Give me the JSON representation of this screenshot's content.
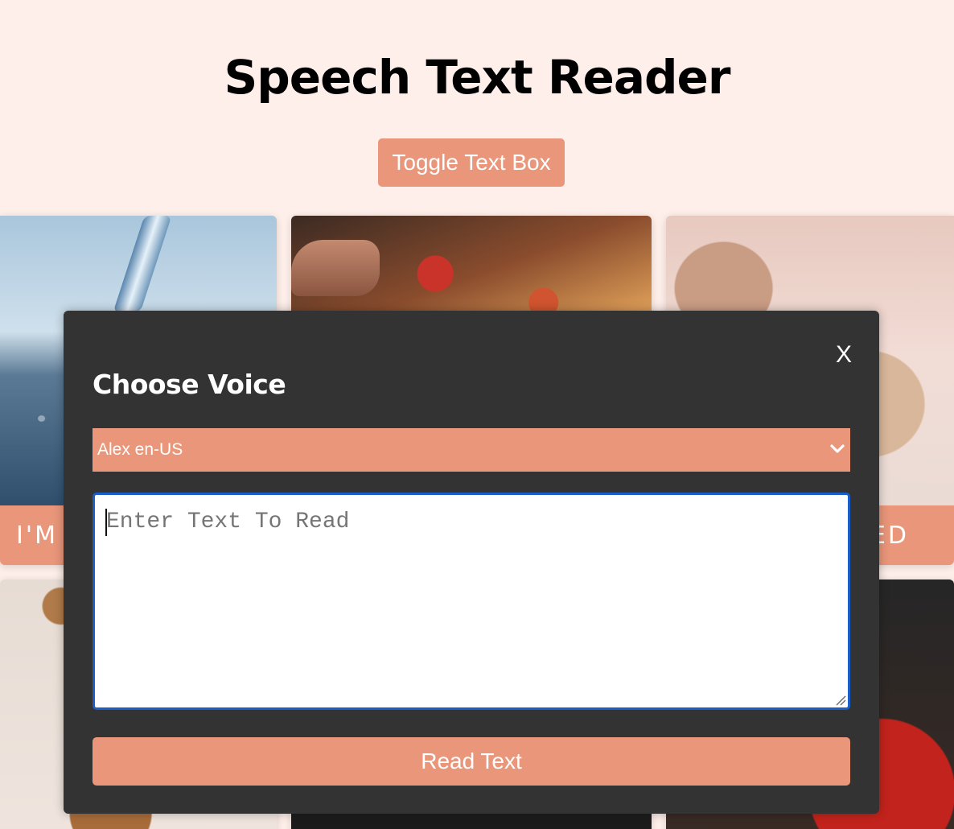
{
  "header": {
    "title": "Speech Text Reader",
    "toggle_label": "Toggle Text Box"
  },
  "cards": [
    {
      "label": "I'M"
    },
    {
      "label": ""
    },
    {
      "label": "ED"
    }
  ],
  "modal": {
    "close_label": "X",
    "title": "Choose Voice",
    "voice_selected": "Alex en-US",
    "textarea_placeholder": "Enter Text To Read",
    "read_button_label": "Read Text"
  },
  "colors": {
    "accent": "#e9967a",
    "page_bg": "#ffefea",
    "modal_bg": "#333333",
    "focus_ring": "#1a5fc8"
  }
}
